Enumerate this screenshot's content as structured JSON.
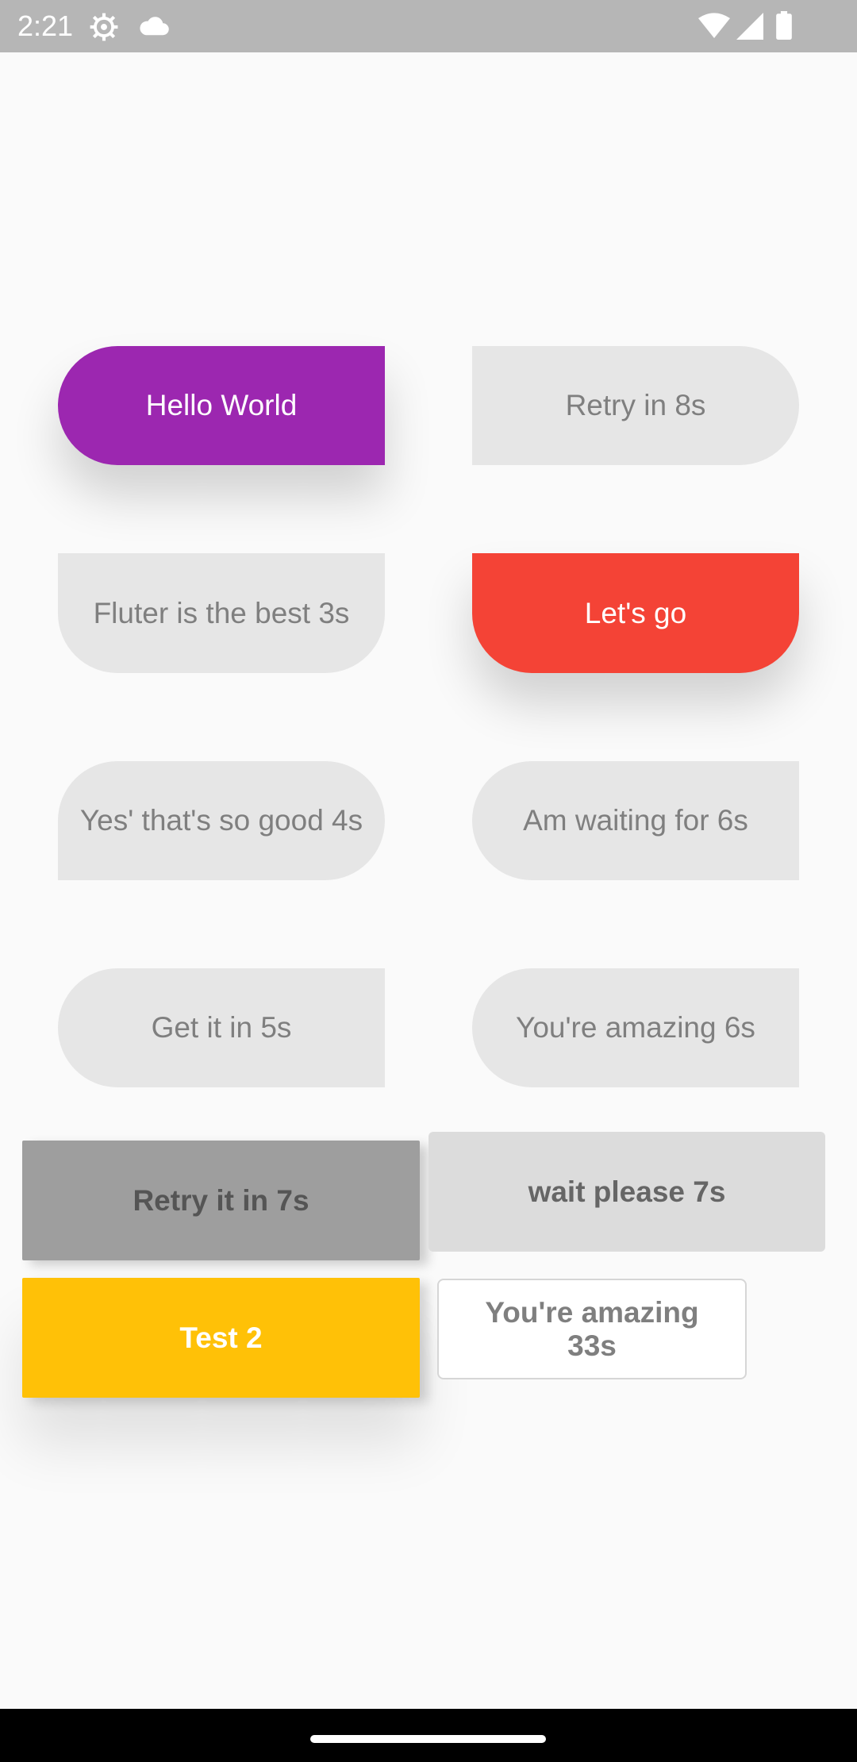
{
  "status_bar": {
    "time": "2:21",
    "icons": [
      "settings-icon",
      "cloud-icon",
      "wifi-icon",
      "signal-icon",
      "battery-icon"
    ]
  },
  "buttons": {
    "hello_world": "Hello World",
    "retry_8s": "Retry in 8s",
    "fluter_best": "Fluter is the best 3s",
    "lets_go": "Let's go",
    "yes_good": "Yes' that's so good 4s",
    "waiting_6s": "Am waiting for 6s",
    "get_it_5s": "Get it in 5s",
    "amazing_6s": "You're amazing 6s",
    "retry_it_7s": "Retry it in 7s",
    "wait_please": "wait please 7s",
    "test_2": "Test 2",
    "amazing_33s": "You're amazing 33s"
  },
  "colors": {
    "purple": "#9c27b0",
    "red": "#f44336",
    "amber": "#ffc107",
    "grey_pill": "#e6e6e6",
    "dark_grey": "#9e9e9e",
    "light_grey": "#dcdcdc"
  }
}
